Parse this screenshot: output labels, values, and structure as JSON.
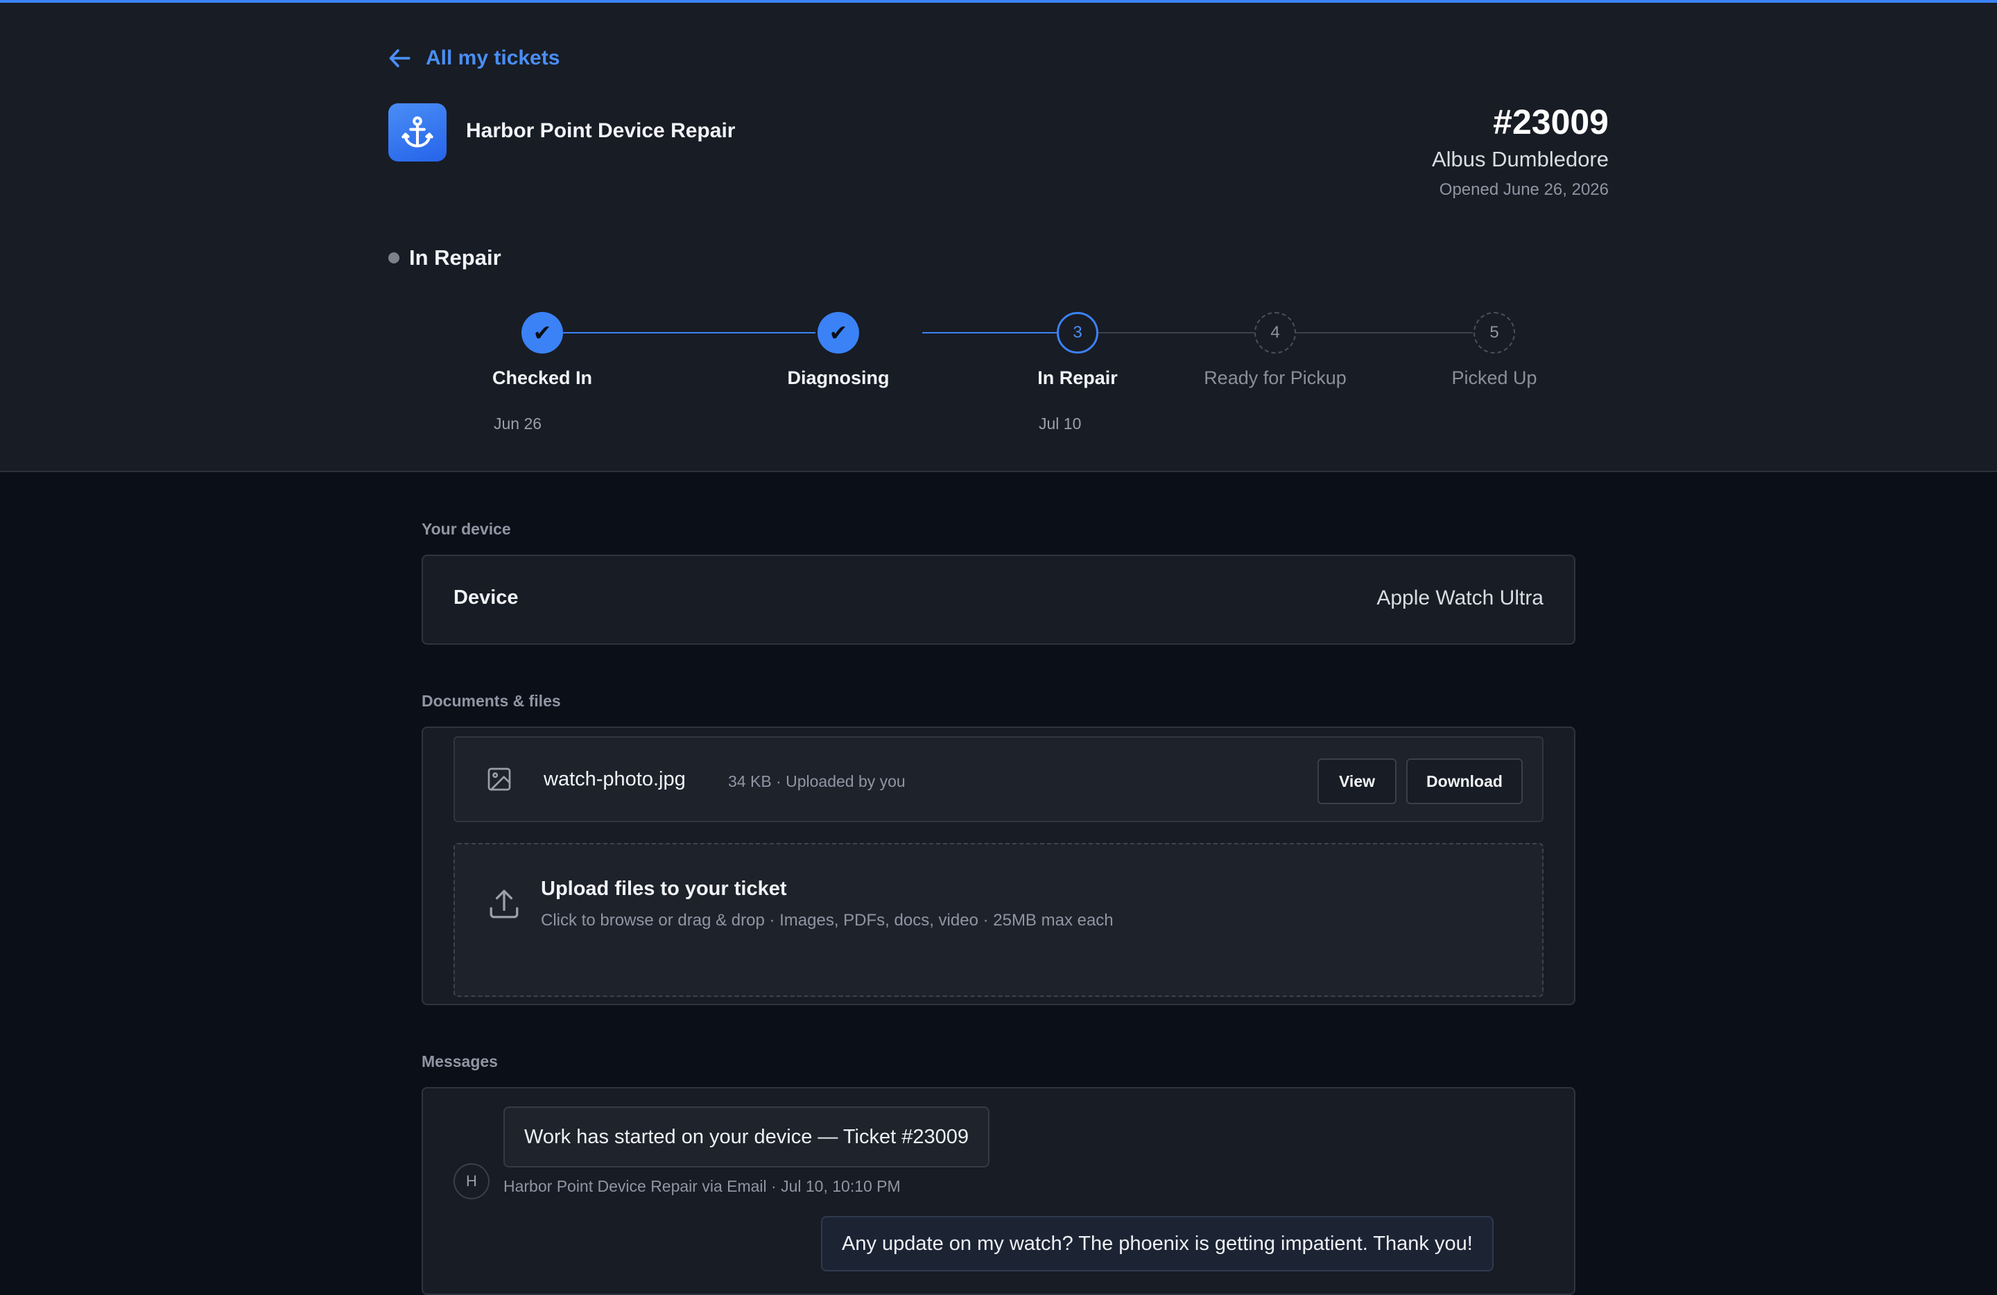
{
  "nav": {
    "back_label": "All my tickets"
  },
  "shop": {
    "name": "Harbor Point Device Repair",
    "logo_icon": "anchor-icon"
  },
  "ticket": {
    "number": "#23009",
    "customer": "Albus Dumbledore",
    "opened": "Opened June 26, 2026",
    "status": "In Repair"
  },
  "steps": [
    {
      "marker": "✔",
      "label": "Checked In",
      "date": "Jun 26",
      "state": "done"
    },
    {
      "marker": "✔",
      "label": "Diagnosing",
      "date": "",
      "state": "done"
    },
    {
      "marker": "3",
      "label": "In Repair",
      "date": "Jul 10",
      "state": "current"
    },
    {
      "marker": "4",
      "label": "Ready for Pickup",
      "date": "",
      "state": "future"
    },
    {
      "marker": "5",
      "label": "Picked Up",
      "date": "",
      "state": "future"
    }
  ],
  "device_section": {
    "title": "Your device",
    "key": "Device",
    "value": "Apple Watch Ultra"
  },
  "files_section": {
    "title": "Documents & files",
    "files": [
      {
        "name": "watch-photo.jpg",
        "meta": "34 KB · Uploaded by you",
        "view_label": "View",
        "download_label": "Download"
      }
    ],
    "upload": {
      "title": "Upload files to your ticket",
      "hint": "Click to browse or drag & drop · Images, PDFs, docs, video · 25MB max each"
    }
  },
  "messages_section": {
    "title": "Messages",
    "messages": [
      {
        "text": "Work has started on your device — Ticket #23009",
        "avatar": "H",
        "meta": "Harbor Point Device Repair via Email · Jul 10, 10:10 PM"
      },
      {
        "text": "Any update on my watch? The phoenix is getting impatient. Thank you!"
      }
    ]
  },
  "colors": {
    "accent": "#3b82f6",
    "header_bg": "#181c24",
    "page_bg": "#0b0f17"
  }
}
